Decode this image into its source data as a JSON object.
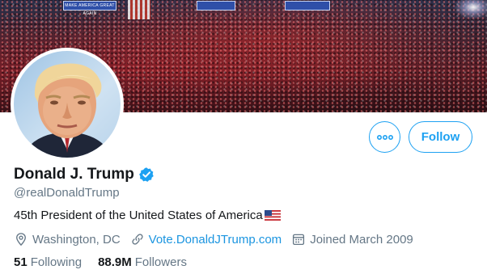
{
  "banner": {
    "icon": "rally-crowd-banner",
    "sign_texts": [
      "MAKE AMERICA GREAT AGAIN",
      "",
      ""
    ]
  },
  "avatar": {
    "icon": "profile-photo"
  },
  "actions": {
    "more_icon": "more-dots-icon",
    "follow_label": "Follow",
    "accent": "#1da1f2"
  },
  "profile": {
    "display_name": "Donald J. Trump",
    "verified_icon": "verified-badge-icon",
    "handle": "@realDonaldTrump",
    "bio": "45th President of the United States of America",
    "bio_emoji": "us-flag-emoji"
  },
  "meta": {
    "location": "Washington, DC",
    "location_icon": "location-pin-icon",
    "website": "Vote.DonaldJTrump.com",
    "website_icon": "link-icon",
    "joined": "Joined March 2009",
    "joined_icon": "calendar-icon"
  },
  "stats": {
    "following_count": "51",
    "following_label": "Following",
    "followers_count": "88.9M",
    "followers_label": "Followers"
  },
  "colors": {
    "text_primary": "#14171a",
    "text_secondary": "#657786",
    "link": "#1b95e0"
  }
}
